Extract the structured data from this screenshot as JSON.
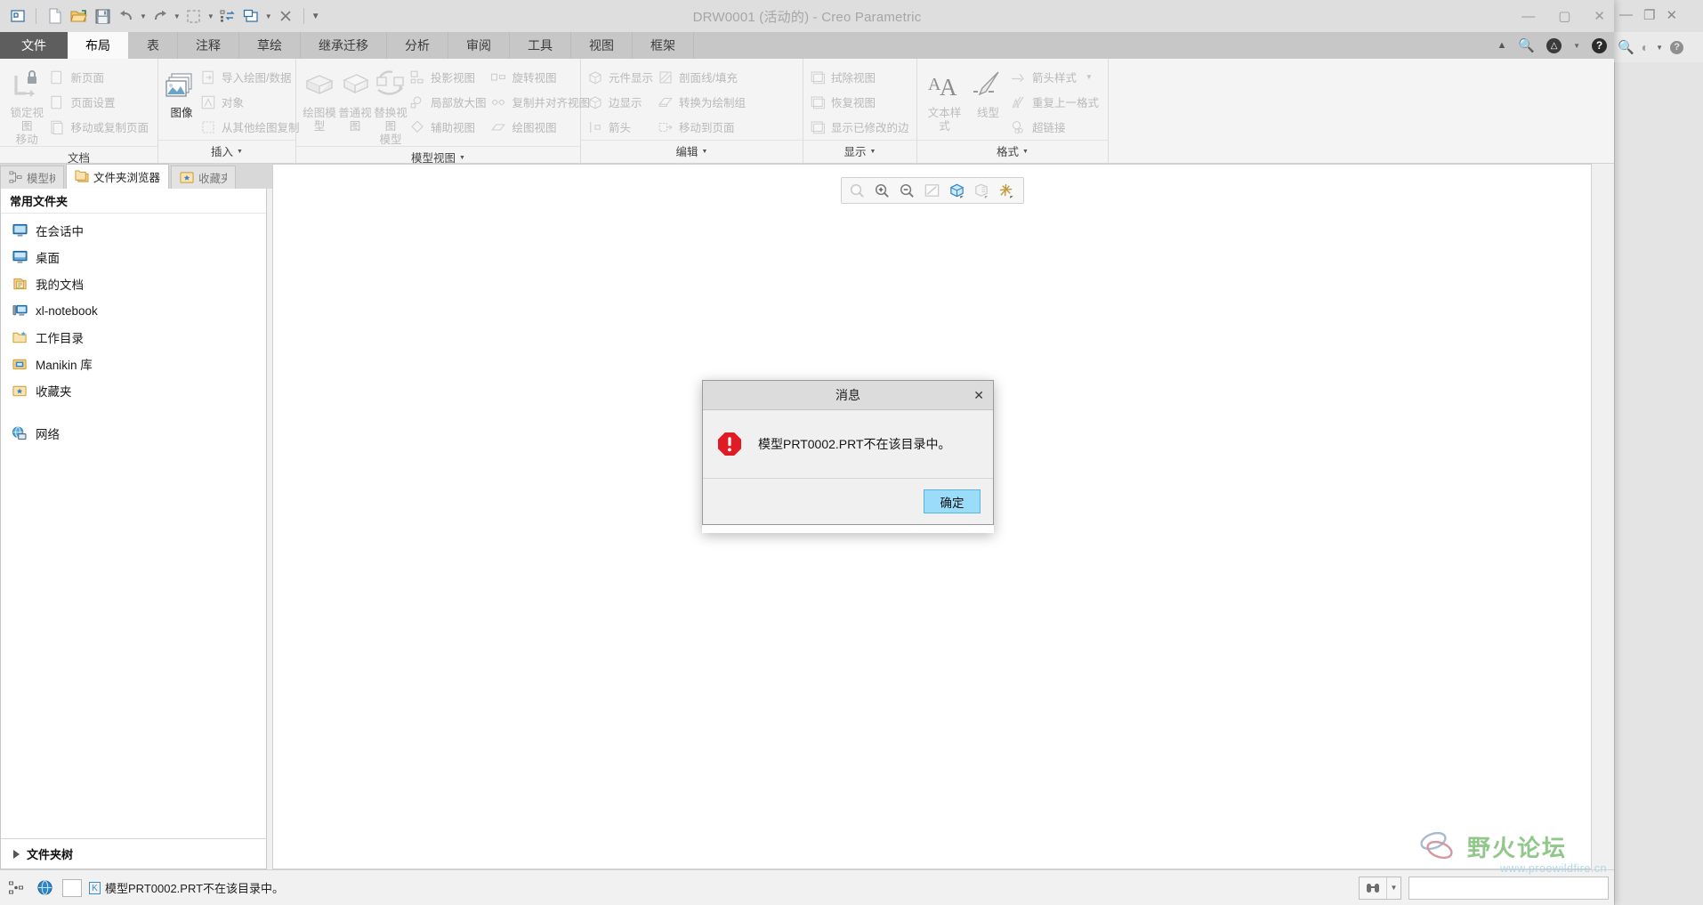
{
  "window": {
    "title": "DRW0001 (活动的) - Creo Parametric",
    "controls": {
      "minimize": "—",
      "maximize": "▢",
      "close": "✕"
    }
  },
  "quick_access": {
    "items": [
      {
        "name": "new-window-icon",
        "label": "新建窗口"
      },
      {
        "name": "new-file-icon",
        "label": "新建"
      },
      {
        "name": "open-file-icon",
        "label": "打开"
      },
      {
        "name": "save-icon",
        "label": "保存"
      },
      {
        "name": "undo-icon",
        "label": "撤消"
      },
      {
        "name": "redo-icon",
        "label": "重做"
      },
      {
        "name": "select-icon",
        "label": "选择"
      },
      {
        "name": "regenerate-icon",
        "label": "重新生成"
      },
      {
        "name": "window-switch-icon",
        "label": "窗口"
      },
      {
        "name": "close-window-icon",
        "label": "关闭"
      },
      {
        "name": "customize-qat-icon",
        "label": "自定义快速访问工具栏"
      }
    ]
  },
  "tabs": [
    {
      "id": "file",
      "label": "文件",
      "state": "file"
    },
    {
      "id": "layout",
      "label": "布局",
      "state": "active"
    },
    {
      "id": "table",
      "label": "表",
      "state": "normal"
    },
    {
      "id": "annotate",
      "label": "注释",
      "state": "normal"
    },
    {
      "id": "sketch",
      "label": "草绘",
      "state": "normal"
    },
    {
      "id": "inherit",
      "label": "继承迁移",
      "state": "normal"
    },
    {
      "id": "analysis",
      "label": "分析",
      "state": "normal"
    },
    {
      "id": "review",
      "label": "审阅",
      "state": "normal"
    },
    {
      "id": "tools",
      "label": "工具",
      "state": "normal"
    },
    {
      "id": "view",
      "label": "视图",
      "state": "normal"
    },
    {
      "id": "framework",
      "label": "框架",
      "state": "normal"
    }
  ],
  "tab_right_icons": [
    {
      "name": "collapse-ribbon-icon"
    },
    {
      "name": "search-icon"
    },
    {
      "name": "graduation-cap-icon"
    },
    {
      "name": "chevron-down-icon"
    },
    {
      "name": "help-icon"
    }
  ],
  "ribbon": {
    "groups": [
      {
        "id": "document",
        "label": "文档",
        "has_dropdown": false,
        "big": [
          {
            "name": "lock-view-movement-button",
            "label_line1": "锁定视图",
            "label_line2": "移动",
            "icon": "lock-view-icon",
            "enabled": false
          }
        ],
        "small": [
          {
            "name": "new-page-button",
            "label": "新页面",
            "icon": "new-page-icon",
            "enabled": false
          },
          {
            "name": "page-setup-button",
            "label": "页面设置",
            "icon": "page-setup-icon",
            "enabled": false
          },
          {
            "name": "move-copy-page-button",
            "label": "移动或复制页面",
            "icon": "move-copy-page-icon",
            "enabled": false
          }
        ]
      },
      {
        "id": "insert",
        "label": "插入",
        "has_dropdown": true,
        "big": [
          {
            "name": "image-button",
            "label_line1": "图像",
            "label_line2": "",
            "icon": "image-icon",
            "enabled": true
          }
        ],
        "small": [
          {
            "name": "import-drawing-data-button",
            "label": "导入绘图/数据",
            "icon": "import-drawing-icon",
            "enabled": false
          },
          {
            "name": "object-button",
            "label": "对象",
            "icon": "object-icon",
            "enabled": false
          },
          {
            "name": "copy-from-other-drawing-button",
            "label": "从其他绘图复制",
            "icon": "copy-from-other-icon",
            "enabled": false
          }
        ]
      },
      {
        "id": "model-views",
        "label": "模型视图",
        "has_dropdown": true,
        "big": [
          {
            "name": "drawing-model-button",
            "label_line1": "绘图模型",
            "label_line2": "",
            "icon": "drawing-model-icon",
            "enabled": false
          },
          {
            "name": "general-view-button",
            "label_line1": "普通视图",
            "label_line2": "",
            "icon": "general-view-icon",
            "enabled": false
          },
          {
            "name": "replace-view-model-button",
            "label_line1": "替换视图",
            "label_line2": "模型",
            "icon": "replace-view-icon",
            "enabled": false
          }
        ],
        "small": [
          {
            "name": "projection-view-button",
            "label": "投影视图",
            "icon": "projection-view-icon",
            "enabled": false
          },
          {
            "name": "detailed-view-button",
            "label": "局部放大图",
            "icon": "detailed-view-icon",
            "enabled": false
          },
          {
            "name": "auxiliary-view-button",
            "label": "辅助视图",
            "icon": "auxiliary-view-icon",
            "enabled": false
          }
        ],
        "small2": [
          {
            "name": "revolved-view-button",
            "label": "旋转视图",
            "icon": "revolved-view-icon",
            "enabled": false
          },
          {
            "name": "copy-align-view-button",
            "label": "复制并对齐视图",
            "icon": "copy-align-view-icon",
            "enabled": false
          },
          {
            "name": "drawing-view-button",
            "label": "绘图视图",
            "icon": "drawing-view-icon",
            "enabled": false
          }
        ]
      },
      {
        "id": "edit",
        "label": "编辑",
        "has_dropdown": true,
        "small": [
          {
            "name": "component-display-button",
            "label": "元件显示",
            "icon": "component-display-icon",
            "enabled": false
          },
          {
            "name": "edge-display-button",
            "label": "边显示",
            "icon": "edge-display-icon",
            "enabled": false
          },
          {
            "name": "arrows-button",
            "label": "箭头",
            "icon": "arrows-icon",
            "enabled": false
          }
        ],
        "small2": [
          {
            "name": "hatch-fill-button",
            "label": "剖面线/填充",
            "icon": "hatch-fill-icon",
            "enabled": false
          },
          {
            "name": "convert-to-draft-group-button",
            "label": "转换为绘制组",
            "icon": "convert-draft-icon",
            "enabled": false
          },
          {
            "name": "move-to-sheet-button",
            "label": "移动到页面",
            "icon": "move-to-sheet-icon",
            "enabled": false
          }
        ]
      },
      {
        "id": "display",
        "label": "显示",
        "has_dropdown": true,
        "small": [
          {
            "name": "erase-view-button",
            "label": "拭除视图",
            "icon": "erase-view-icon",
            "enabled": false
          },
          {
            "name": "resume-view-button",
            "label": "恢复视图",
            "icon": "resume-view-icon",
            "enabled": false
          },
          {
            "name": "show-modified-edges-button",
            "label": "显示已修改的边",
            "icon": "show-modified-edges-icon",
            "enabled": false
          }
        ]
      },
      {
        "id": "format",
        "label": "格式",
        "has_dropdown": true,
        "big": [
          {
            "name": "text-style-button",
            "label_line1": "文本样式",
            "label_line2": "",
            "icon": "text-style-icon",
            "enabled": false
          },
          {
            "name": "line-style-button",
            "label_line1": "线型",
            "label_line2": "",
            "icon": "line-style-icon",
            "enabled": false
          }
        ],
        "small": [
          {
            "name": "arrow-style-button",
            "label": "箭头样式",
            "icon": "arrow-style-icon",
            "enabled": false,
            "dropdown": true
          },
          {
            "name": "repeat-last-format-button",
            "label": "重复上一格式",
            "icon": "repeat-format-icon",
            "enabled": false
          },
          {
            "name": "hyperlink-button",
            "label": "超链接",
            "icon": "hyperlink-icon",
            "enabled": false
          }
        ]
      }
    ]
  },
  "left_dock": {
    "tabs": [
      {
        "id": "model",
        "label": "模型树",
        "icon": "model-tree-icon",
        "active": false
      },
      {
        "id": "folder-browser",
        "label": "文件夹浏览器",
        "icon": "folder-browser-icon",
        "active": true
      },
      {
        "id": "favorites",
        "label": "收藏夹",
        "icon": "favorites-icon",
        "active": false
      }
    ],
    "section_title": "常用文件夹",
    "items": [
      {
        "name": "sidebar-item-in-session",
        "label": "在会话中",
        "icon": "monitor-icon"
      },
      {
        "name": "sidebar-item-desktop",
        "label": "桌面",
        "icon": "desktop-icon"
      },
      {
        "name": "sidebar-item-my-documents",
        "label": "我的文档",
        "icon": "documents-icon"
      },
      {
        "name": "sidebar-item-xl-notebook",
        "label": "xl-notebook",
        "icon": "computer-icon"
      },
      {
        "name": "sidebar-item-working-directory",
        "label": "工作目录",
        "icon": "working-folder-icon"
      },
      {
        "name": "sidebar-item-manikin-library",
        "label": "Manikin 库",
        "icon": "library-folder-icon"
      },
      {
        "name": "sidebar-item-favorites",
        "label": "收藏夹",
        "icon": "favorites-folder-icon"
      }
    ],
    "network": {
      "name": "sidebar-item-network",
      "label": "网络",
      "icon": "network-icon"
    },
    "footer": {
      "label": "文件夹树"
    }
  },
  "graphics_toolbar": {
    "buttons": [
      {
        "name": "repaint-icon",
        "label": "重画",
        "enabled": false
      },
      {
        "name": "zoom-in-icon",
        "label": "放大",
        "enabled": true
      },
      {
        "name": "zoom-out-icon",
        "label": "缩小",
        "enabled": true
      },
      {
        "name": "refit-icon",
        "label": "重新调整",
        "enabled": false
      },
      {
        "name": "display-style-icon",
        "label": "显示样式",
        "enabled": true
      },
      {
        "name": "saved-orientations-icon",
        "label": "已保存方向",
        "enabled": false
      },
      {
        "name": "datum-display-icon",
        "label": "基准显示过滤器",
        "enabled": true
      }
    ]
  },
  "dialog": {
    "title": "消息",
    "close_label": "✕",
    "icon": "error-icon",
    "message": "模型PRT0002.PRT不在该目录中。",
    "ok_label": "确定",
    "accent_color": "#9bdcfb"
  },
  "status_bar": {
    "left_icons": [
      {
        "name": "model-tree-filter-icon"
      },
      {
        "name": "globe-icon"
      },
      {
        "name": "empty-box-icon"
      }
    ],
    "message_icon": "message-badge-icon",
    "message": "模型PRT0002.PRT不在该目录中。",
    "right_group": [
      {
        "name": "find-icon",
        "label": "查找"
      },
      {
        "name": "find-dropdown-icon",
        "label": "▾"
      }
    ],
    "field_value": "",
    "field_placeholder": ""
  },
  "watermark": {
    "text": "野火论坛",
    "url": "www.proewildfire.cn"
  },
  "background_window": {
    "controls": {
      "minimize": "—",
      "restore": "❐",
      "close": "✕"
    },
    "icons": [
      {
        "name": "search-icon"
      },
      {
        "name": "graduation-cap-icon"
      },
      {
        "name": "chevron-down-icon"
      },
      {
        "name": "help-icon"
      }
    ]
  }
}
